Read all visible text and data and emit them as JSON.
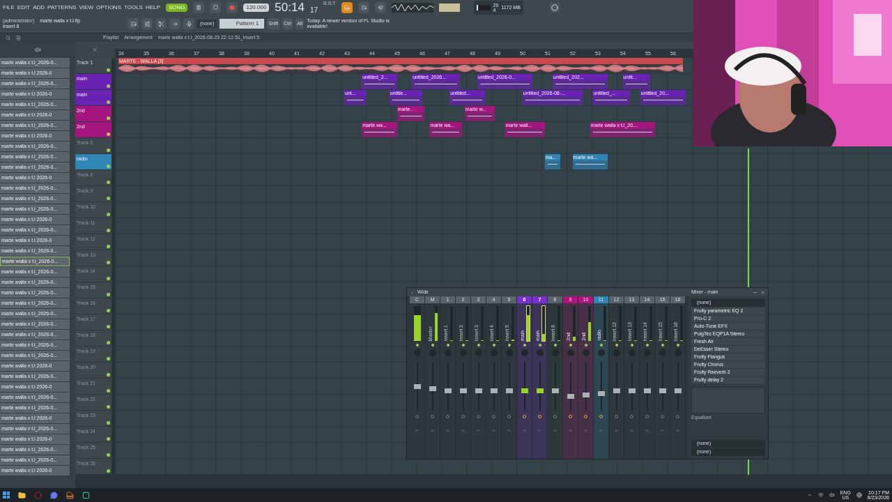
{
  "menu": [
    "FILE",
    "EDIT",
    "ADD",
    "PATTERNS",
    "VIEW",
    "OPTIONS",
    "TOOLS",
    "HELP"
  ],
  "transport": {
    "mode_label": "SONG",
    "song_mode": true,
    "tempo": "120.000",
    "time": "50:14",
    "ticks": "17",
    "unit": "B:S:T"
  },
  "cpu": {
    "polyphony": "20",
    "memory": "1172 MB",
    "cores": "4",
    "level": 0.12
  },
  "hint": {
    "user": "(administrator)",
    "file": "marte walla x t.l.flp",
    "target": "Insert 8"
  },
  "pattern": {
    "instrument": "(none)",
    "name": "Pattern 1"
  },
  "keys": [
    "Shift",
    "Ctrl",
    "Alt"
  ],
  "news": "Today: A newer version of FL Studio is available!",
  "playlist": {
    "title": "Playlist",
    "view": "Arrangement",
    "clip": "marte walla x t.l_2026-08-23 22-12-51_Insert 5",
    "ruler": [
      "34",
      "35",
      "36",
      "37",
      "38",
      "39",
      "40",
      "41",
      "42",
      "43",
      "44",
      "45",
      "46",
      "47",
      "48",
      "49",
      "50",
      "51",
      "52",
      "53",
      "54",
      "55",
      "56"
    ],
    "tracks": [
      {
        "name": "Track 1",
        "kind": "audio",
        "clips": [
          "MARTE - WALLA [3]"
        ]
      },
      {
        "name": "main",
        "color": "#6a22b4",
        "clips": [
          "untitled_2...",
          "untitled_2026...",
          "untitled_2026-0...",
          "untitled_202...",
          "untit..."
        ]
      },
      {
        "name": "main",
        "color": "#6a22b4",
        "clips": [
          "unt...",
          "untitle...",
          "untitled...",
          "untitled_2026-08-...",
          "untitled_...",
          "untitled_20..."
        ]
      },
      {
        "name": "2nd",
        "color": "#a5157f",
        "clips": [
          "marte...",
          "marte w..."
        ]
      },
      {
        "name": "2nd",
        "color": "#a5157f",
        "clips": [
          "marte wa...",
          "marte wa...",
          "marte wall...",
          "marte walla x t.l_20..."
        ]
      },
      {
        "name": "Track 6"
      },
      {
        "name": "radio",
        "color": "#2f86b5",
        "clips": [
          "ma...",
          "marte wa..."
        ]
      },
      {
        "name": "Track 8"
      },
      {
        "name": "Track 9"
      },
      {
        "name": "Track 10"
      },
      {
        "name": "Track 11"
      },
      {
        "name": "Track 12"
      },
      {
        "name": "Track 13"
      },
      {
        "name": "Track 14"
      },
      {
        "name": "Track 15"
      },
      {
        "name": "Track 16"
      },
      {
        "name": "Track 17"
      },
      {
        "name": "Track 18"
      },
      {
        "name": "Track 19"
      },
      {
        "name": "Track 20"
      },
      {
        "name": "Track 21"
      },
      {
        "name": "Track 22"
      },
      {
        "name": "Track 23"
      },
      {
        "name": "Track 24"
      },
      {
        "name": "Track 25"
      },
      {
        "name": "Track 26"
      }
    ]
  },
  "browser": [
    {
      "label": "marte walla x t.l_2026-0...",
      "selected": false
    },
    {
      "label": "marte walla x t.l 2026-0",
      "selected": false
    },
    {
      "label": "marte walla x t.l_2026-0...",
      "selected": false
    },
    {
      "label": "marte walla x t.l 2026-0",
      "selected": false
    },
    {
      "label": "marte walla x t.l_2026-0...",
      "selected": false
    },
    {
      "label": "marte walla x t.l 2026-0",
      "selected": false
    },
    {
      "label": "marte walla x t.l_2026-0...",
      "selected": false
    },
    {
      "label": "marte walla x t.l 2026-0",
      "selected": false
    },
    {
      "label": "marte walla x t.l_2026-0...",
      "selected": false
    },
    {
      "label": "marte walla x t.l_2026-0...",
      "selected": false
    },
    {
      "label": "marte walla x t.l_2026-0...",
      "selected": false
    },
    {
      "label": "marte walla x t.l 2026-0",
      "selected": false
    },
    {
      "label": "marte walla x t.l_2026-0...",
      "selected": false
    },
    {
      "label": "marte walla x t.l_2026-0...",
      "selected": false
    },
    {
      "label": "marte walla x t.l_2026-0...",
      "selected": false
    },
    {
      "label": "marte walla x t.l 2026-0",
      "selected": false
    },
    {
      "label": "marte walla x t.l_2026-0...",
      "selected": false
    },
    {
      "label": "marte walla x t.l 2026-0",
      "selected": false
    },
    {
      "label": "marte walla x t.l_2026-0...",
      "selected": false
    },
    {
      "label": "marte walla x t.l_2026-0...",
      "selected": true
    },
    {
      "label": "marte walla x t.l_2026-0...",
      "selected": false
    },
    {
      "label": "marte walla x t.l_2026-0...",
      "selected": false
    },
    {
      "label": "marte walla x t.l_2026-0...",
      "selected": false
    },
    {
      "label": "marte walla x t.l_2026-0...",
      "selected": false
    },
    {
      "label": "marte walla x t.l_2026-0...",
      "selected": false
    },
    {
      "label": "marte walla x t.l_2026-0...",
      "selected": false
    },
    {
      "label": "marte walla x t.l_2026-0...",
      "selected": false
    },
    {
      "label": "marte walla x t.l_2026-0...",
      "selected": false
    },
    {
      "label": "marte walla x t.l_2026-0...",
      "selected": false
    },
    {
      "label": "marte walla x t.l 2026-0",
      "selected": false
    },
    {
      "label": "marte walla x t.l_2026-0...",
      "selected": false
    },
    {
      "label": "marte walla x t.l 2026-0",
      "selected": false
    },
    {
      "label": "marte walla x t.l_2026-0...",
      "selected": false
    },
    {
      "label": "marte walla x t.l_2026-0...",
      "selected": false
    },
    {
      "label": "marte walla x t.l 2026-0",
      "selected": false
    },
    {
      "label": "marte walla x t.l_2026-0...",
      "selected": false
    },
    {
      "label": "marte walla x t.l 2026-0",
      "selected": false
    },
    {
      "label": "marte walla x t.l_2026-0...",
      "selected": false
    },
    {
      "label": "marte walla x t.l_2026-0...",
      "selected": false
    },
    {
      "label": "marte walla x t.l 2026-0",
      "selected": false
    }
  ],
  "mixer": {
    "title": "Wide",
    "panel_title": "Mixer - main",
    "strips": [
      {
        "number": "C",
        "kind": "current",
        "meter": {
          "level": 0.75
        },
        "fader": {
          "level": 0.5
        },
        "selected": false
      },
      {
        "number": "M",
        "name": "Master",
        "kind": "insert",
        "meter": {
          "level": 0.8
        },
        "fader": {
          "level": 0.45
        },
        "selected": false
      },
      {
        "number": "1",
        "name": "Insert 1",
        "kind": "insert",
        "meter": {
          "level": 0
        },
        "fader": {
          "level": 0.4
        },
        "selected": false
      },
      {
        "number": "2",
        "name": "Insert 2",
        "kind": "insert",
        "meter": {
          "level": 0
        },
        "fader": {
          "level": 0.4
        },
        "selected": false
      },
      {
        "number": "3",
        "name": "Insert 3",
        "kind": "insert",
        "meter": {
          "level": 0
        },
        "fader": {
          "level": 0.4
        },
        "selected": false
      },
      {
        "number": "4",
        "name": "Insert 4",
        "kind": "insert",
        "meter": {
          "level": 0
        },
        "fader": {
          "level": 0.4
        },
        "selected": false
      },
      {
        "number": "5",
        "name": "Insert 5",
        "kind": "insert",
        "meter": {
          "level": 0.05
        },
        "fader": {
          "level": 0.4
        },
        "selected": false
      },
      {
        "number": "6",
        "name": "main",
        "kind": "insert",
        "color": "#7a2fd0",
        "meter": {
          "level": 0.75
        },
        "fader": {
          "level": 0.4
        },
        "selected": true
      },
      {
        "number": "7",
        "name": "main",
        "kind": "insert",
        "color": "#7a2fd0",
        "meter": {
          "level": 0.2
        },
        "fader": {
          "level": 0.4
        },
        "selected": true
      },
      {
        "number": "8",
        "name": "Insert 8",
        "kind": "insert",
        "meter": {
          "level": 0
        },
        "fader": {
          "level": 0.4
        },
        "selected": false
      },
      {
        "number": "9",
        "name": "2nd",
        "kind": "insert",
        "color": "#b0157f",
        "meter": {
          "level": 0.12
        },
        "fader": {
          "level": 0.27
        },
        "selected": false
      },
      {
        "number": "10",
        "name": "2nd",
        "kind": "insert",
        "color": "#b0157f",
        "meter": {
          "level": 0.55
        },
        "fader": {
          "level": 0.3
        },
        "selected": false
      },
      {
        "number": "11",
        "name": "radio",
        "kind": "insert",
        "color": "#2f86b5",
        "meter": {
          "level": 0
        },
        "fader": {
          "level": 0.33
        },
        "selected": false
      },
      {
        "number": "12",
        "name": "Insert 12",
        "kind": "insert",
        "meter": {
          "level": 0
        },
        "fader": {
          "level": 0.4
        },
        "selected": false
      },
      {
        "number": "13",
        "name": "Insert 13",
        "kind": "insert",
        "meter": {
          "level": 0
        },
        "fader": {
          "level": 0.4
        },
        "selected": false
      },
      {
        "number": "14",
        "name": "Insert 14",
        "kind": "insert",
        "meter": {
          "level": 0
        },
        "fader": {
          "level": 0.4
        },
        "selected": false
      },
      {
        "number": "15",
        "name": "Insert 15",
        "kind": "insert",
        "meter": {
          "level": 0
        },
        "fader": {
          "level": 0.4
        },
        "selected": false
      },
      {
        "number": "16",
        "name": "Insert 16",
        "kind": "insert",
        "meter": {
          "level": 0
        },
        "fader": {
          "level": 0.4
        },
        "selected": false
      }
    ],
    "input": "(none)",
    "effects": [
      "Fruity parametric EQ 2",
      "Pro-C 2",
      "Auto-Tune EFX",
      "PuigTec EQP1A Stereo",
      "Fresh Air",
      "DeEsser Stereo",
      "Fruity Flangus",
      "Fruity Chorus",
      "Fruity Reeverb 2",
      "Fruity delay 2"
    ],
    "eq_label": "Equalizer",
    "output": "(none)",
    "send": "(none)"
  },
  "tray": {
    "lang": "ENG",
    "region": "US",
    "time": "10:17 PM",
    "date": "8/23/2026"
  }
}
